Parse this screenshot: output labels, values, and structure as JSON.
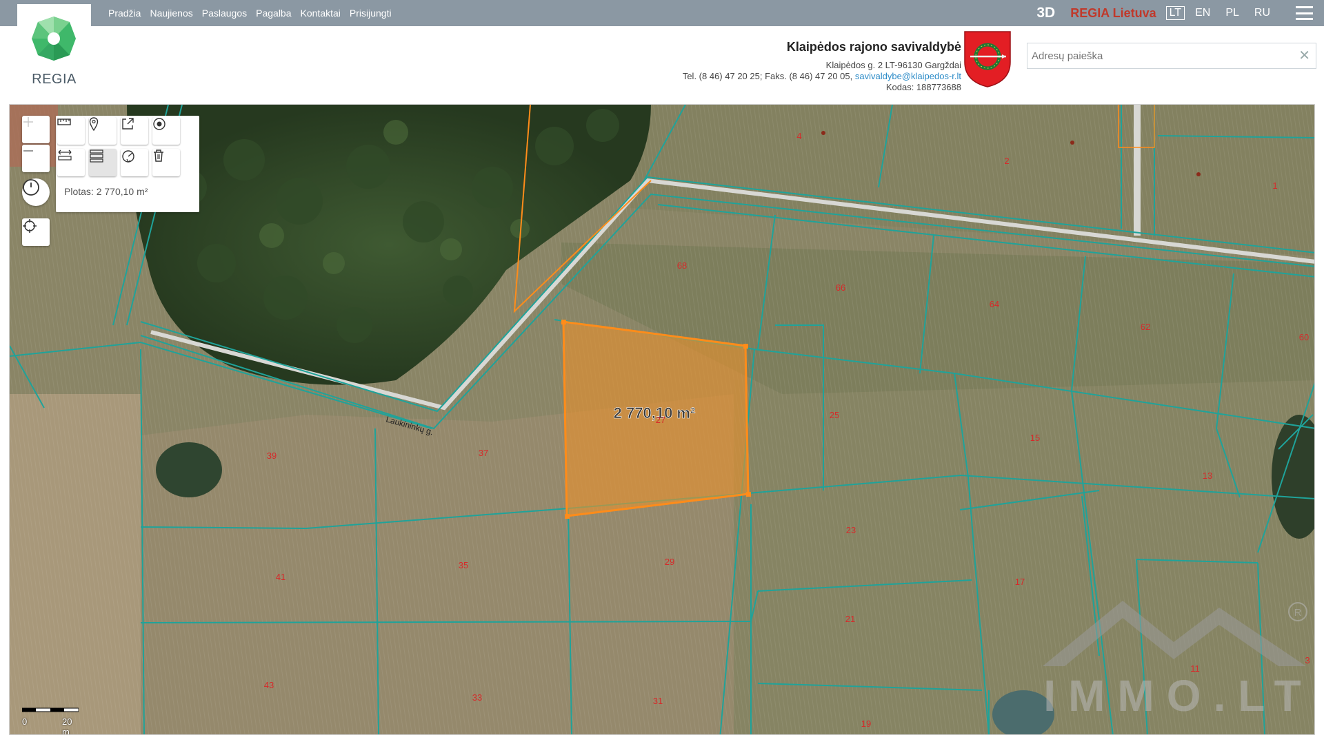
{
  "nav": {
    "items": [
      "Pradžia",
      "Naujienos",
      "Paslaugos",
      "Pagalba",
      "Kontaktai",
      "Prisijungti"
    ]
  },
  "topbar": {
    "btn_3d": "3D",
    "brand": "REGIA Lietuva",
    "languages": [
      "LT",
      "EN",
      "PL",
      "RU"
    ],
    "active_language": "LT"
  },
  "logo": {
    "text": "REGIA"
  },
  "municipality": {
    "name": "Klaipėdos rajono savivaldybė",
    "address": "Klaipėdos g. 2 LT-96130 Gargždai",
    "phone_fax": "Tel. (8 46) 47 20 25; Faks. (8 46) 47 20 05,",
    "email": "savivaldybe@klaipedos-r.lt",
    "code": "Kodas: 188773688"
  },
  "search": {
    "placeholder": "Adresų paieška",
    "value": ""
  },
  "tools": {
    "area_readout": "Plotas: 2 770,10 m²"
  },
  "map": {
    "selected_area_label": "2 770,10 m²",
    "street_label": "Laukininkų g.",
    "parcel_numbers": [
      "4",
      "2",
      "1",
      "68",
      "66",
      "64",
      "62",
      "60",
      "25",
      "15",
      "13",
      "27",
      "37",
      "39",
      "23",
      "29",
      "35",
      "41",
      "17",
      "21",
      "43",
      "33",
      "31",
      "19",
      "11",
      "3"
    ],
    "scale": {
      "min": "0",
      "max": "20 m"
    },
    "watermark": "IMMO.LT",
    "colors": {
      "parcel_border": "#1fa39a",
      "selection_fill": "#e8912d",
      "selection_border": "#ff8c1a",
      "parcel_number": "#d62a2a"
    }
  }
}
